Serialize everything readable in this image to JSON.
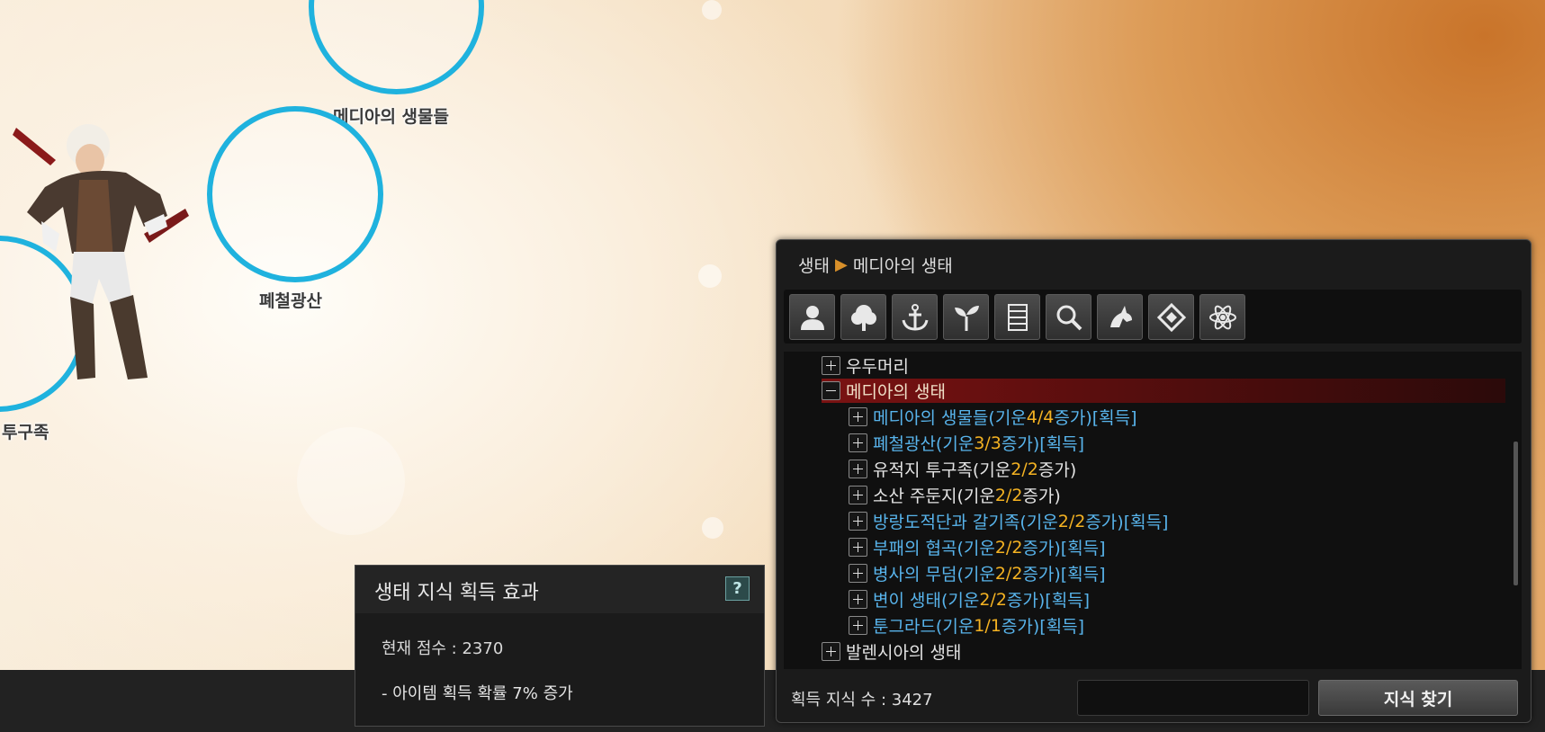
{
  "map": {
    "nodes": [
      {
        "label": "메디아의 생물들"
      },
      {
        "label": "폐철광산"
      },
      {
        "label": "투구족"
      }
    ]
  },
  "panel": {
    "breadcrumb": {
      "root": "생태",
      "current": "메디아의 생태"
    },
    "toolbar_icons": [
      "person-icon",
      "tree-icon",
      "anchor-icon",
      "sprout-icon",
      "bookshelf-icon",
      "magnifier-icon",
      "creature-icon",
      "diamond-icon",
      "atom-icon"
    ],
    "tree": {
      "collapsed_top": {
        "label": "우두머리"
      },
      "expanded": {
        "label": "메디아의 생태"
      },
      "items": [
        {
          "name": "메디아의 생물들(기운 ",
          "count": "4/4",
          "suffix": " 증가)",
          "tag": " [획득]"
        },
        {
          "name": "폐철광산(기운 ",
          "count": "3/3",
          "suffix": " 증가)",
          "tag": " [획득]"
        },
        {
          "name": "유적지 투구족(기운 ",
          "count": "2/2",
          "suffix": " 증가)",
          "tag": ""
        },
        {
          "name": "소산 주둔지(기운 ",
          "count": "2/2",
          "suffix": " 증가)",
          "tag": ""
        },
        {
          "name": "방랑도적단과 갈기족(기운 ",
          "count": "2/2",
          "suffix": " 증가)",
          "tag": " [획득]"
        },
        {
          "name": "부패의 협곡(기운 ",
          "count": "2/2",
          "suffix": " 증가)",
          "tag": " [획득]"
        },
        {
          "name": "병사의 무덤(기운 ",
          "count": "2/2",
          "suffix": " 증가)",
          "tag": " [획득]"
        },
        {
          "name": "변이 생태(기운 ",
          "count": "2/2",
          "suffix": " 증가)",
          "tag": " [획득]"
        },
        {
          "name": "툰그라드(기운 ",
          "count": "1/1",
          "suffix": " 증가)",
          "tag": " [획득]"
        }
      ],
      "collapsed_bottom": {
        "label": "발렌시아의 생태"
      }
    },
    "footer": {
      "known_count": "획득 지식 수 : 3427",
      "search_value": "",
      "find_button": "지식 찾기"
    }
  },
  "effect": {
    "title": "생태 지식 획득 효과",
    "help": "?",
    "score": "현재 점수 : 2370",
    "bonus": "- 아이템 획득 확률 7% 증가"
  },
  "colors": {
    "accent_blue": "#58b4ec",
    "count_orange": "#f4b222",
    "selected_red": "#7a1212",
    "node_ring": "#1fb2de"
  }
}
